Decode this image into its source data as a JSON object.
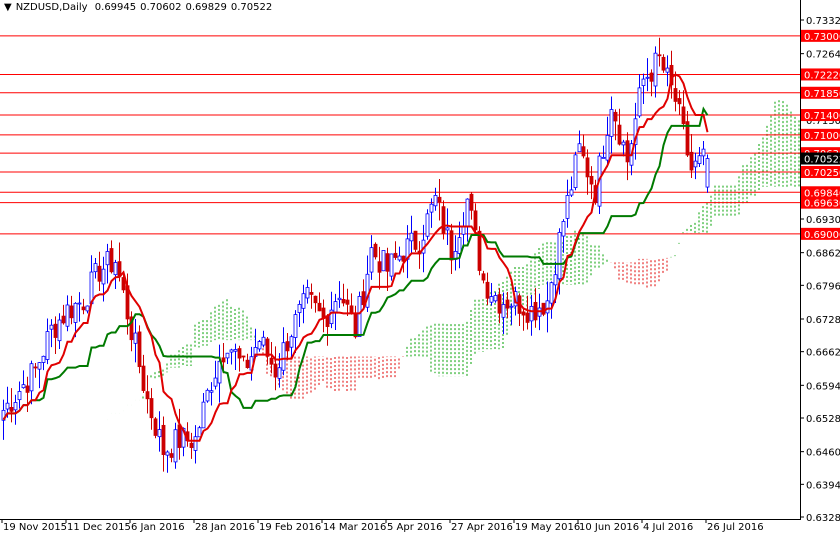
{
  "header": {
    "symbol": "NZDUSD,Daily",
    "open": "0.69945",
    "high": "0.70602",
    "low": "0.69829",
    "close": "0.70522"
  },
  "chart_data": {
    "type": "candlestick",
    "title": "NZDUSD,Daily",
    "indicator": "Ichimoku Kinko Hyo",
    "ylim": [
      0.6328,
      0.7332
    ],
    "y_ticks": [
      "0.73320",
      "0.72640",
      "0.71300",
      "0.69300",
      "0.68620",
      "0.67960",
      "0.67280",
      "0.66620",
      "0.65940",
      "0.65280",
      "0.64600",
      "0.63940",
      "0.63280"
    ],
    "y_tick_values": [
      0.7332,
      0.7264,
      0.713,
      0.693,
      0.6862,
      0.6796,
      0.6728,
      0.6662,
      0.6594,
      0.6528,
      0.646,
      0.6394,
      0.6328
    ],
    "x_labels": [
      "19 Nov 2015",
      "11 Dec 2015",
      "6 Jan 2016",
      "28 Jan 2016",
      "19 Feb 2016",
      "14 Mar 2016",
      "5 Apr 2016",
      "27 Apr 2016",
      "19 May 2016",
      "10 Jun 2016",
      "4 Jul 2016",
      "26 Jul 2016"
    ],
    "bars_per_label": 16,
    "close_keypoints_every_4_bars": [
      0.6544,
      0.6585,
      0.6625,
      0.6706,
      0.6746,
      0.6766,
      0.6827,
      0.6847,
      0.6706,
      0.6564,
      0.6463,
      0.6484,
      0.6484,
      0.6605,
      0.6686,
      0.6625,
      0.6686,
      0.6625,
      0.6706,
      0.6766,
      0.6726,
      0.6787,
      0.6706,
      0.6867,
      0.6827,
      0.6867,
      0.6888,
      0.6968,
      0.6867,
      0.6968,
      0.6807,
      0.6766,
      0.6766,
      0.6746,
      0.6766,
      0.6928,
      0.7069,
      0.6989,
      0.717,
      0.7049,
      0.7211,
      0.7251,
      0.717,
      0.7029,
      0.7052
    ],
    "levels": [
      {
        "label": "0.73000",
        "value": 0.73
      },
      {
        "label": "0.72220",
        "value": 0.7222
      },
      {
        "label": "0.71850",
        "value": 0.7185
      },
      {
        "label": "0.71400",
        "value": 0.714
      },
      {
        "label": "0.71000",
        "value": 0.71
      },
      {
        "label": "0.70630",
        "value": 0.7063
      },
      {
        "label": "0.70250",
        "value": 0.7025
      },
      {
        "label": "0.69840",
        "value": 0.6984
      },
      {
        "label": "0.69630",
        "value": 0.6963
      },
      {
        "label": "0.69000",
        "value": 0.69
      }
    ],
    "current_price": {
      "label": "0.70522",
      "value": 0.70522
    },
    "colors": {
      "level": "#ff0000",
      "up": "#0000ff",
      "down": "#cc0000",
      "tenkan": "#e00000",
      "kijun": "#007a00",
      "cloud_up": "#00a000",
      "cloud_down": "#e00000",
      "current": "#000000"
    }
  }
}
